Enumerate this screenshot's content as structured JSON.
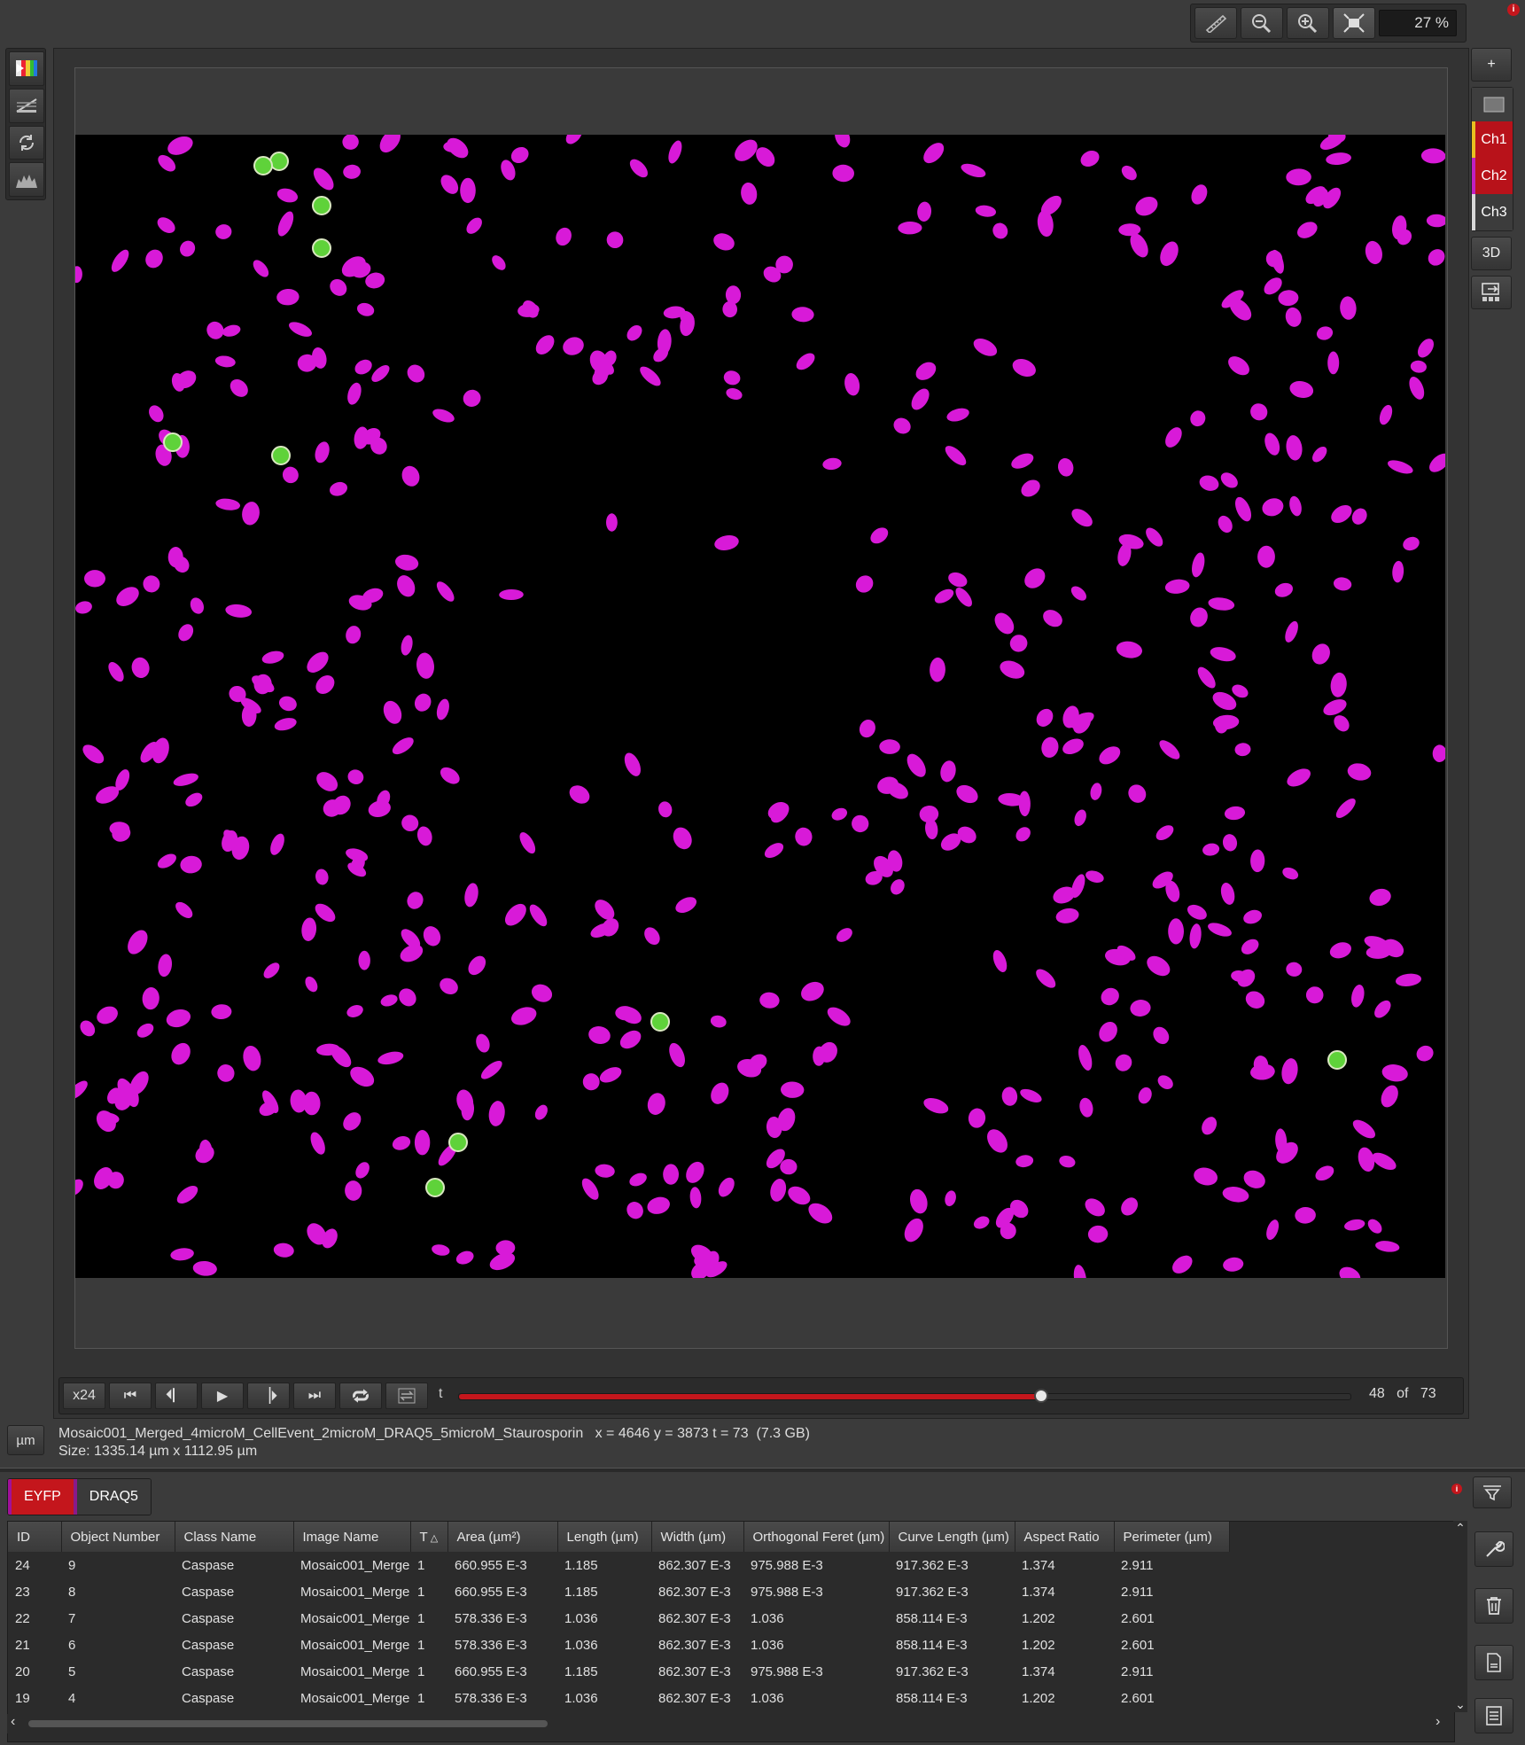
{
  "toolbar": {
    "buttons": [
      "ruler-icon",
      "zoom-out-icon",
      "zoom-in-icon",
      "fit-to-window-icon"
    ],
    "zoom": "27 %"
  },
  "left_tools": [
    "channel-color-icon",
    "display-adjust-icon",
    "refresh-icon",
    "histogram-icon"
  ],
  "right_panel": {
    "add": "+",
    "channels": [
      {
        "label": "Ch1",
        "color": "#b8121a",
        "stripe": "#e8c020"
      },
      {
        "label": "Ch2",
        "color": "#b8121a",
        "stripe": "#c020c0"
      },
      {
        "label": "Ch3",
        "color": "#3c3c3c",
        "stripe": "#d8d8d8"
      }
    ],
    "three_d": "3D"
  },
  "playback": {
    "speed": "x24",
    "t_label": "t",
    "current": "48",
    "of_label": "of",
    "total": "73",
    "progress": 0.653
  },
  "status": {
    "unit": "µm",
    "file_line": "Mosaic001_Merged_4microM_CellEvent_2microM_DRAQ5_5microM_Staurosporin   x = 4646 y = 3873 t = 73  (7.3 GB)",
    "size_line": "Size: 1335.14 µm x 1112.95 µm"
  },
  "tabs": [
    {
      "label": "EYFP",
      "active": true
    },
    {
      "label": "DRAQ5",
      "active": false
    }
  ],
  "table": {
    "columns": [
      "ID",
      "Object Number",
      "Class Name",
      "Image Name",
      "T",
      "Area (µm²)",
      "Length (µm)",
      "Width (µm)",
      "Orthogonal Feret (µm)",
      "Curve Length (µm)",
      "Aspect Ratio",
      "Perimeter (µm)"
    ],
    "rows": [
      [
        "24",
        "9",
        "Caspase",
        "Mosaic001_Merge",
        "1",
        "660.955 E-3",
        "1.185",
        "862.307 E-3",
        "975.988 E-3",
        "917.362 E-3",
        "1.374",
        "2.911"
      ],
      [
        "23",
        "8",
        "Caspase",
        "Mosaic001_Merge",
        "1",
        "660.955 E-3",
        "1.185",
        "862.307 E-3",
        "975.988 E-3",
        "917.362 E-3",
        "1.374",
        "2.911"
      ],
      [
        "22",
        "7",
        "Caspase",
        "Mosaic001_Merge",
        "1",
        "578.336 E-3",
        "1.036",
        "862.307 E-3",
        "1.036",
        "858.114 E-3",
        "1.202",
        "2.601"
      ],
      [
        "21",
        "6",
        "Caspase",
        "Mosaic001_Merge",
        "1",
        "578.336 E-3",
        "1.036",
        "862.307 E-3",
        "1.036",
        "858.114 E-3",
        "1.202",
        "2.601"
      ],
      [
        "20",
        "5",
        "Caspase",
        "Mosaic001_Merge",
        "1",
        "660.955 E-3",
        "1.185",
        "862.307 E-3",
        "975.988 E-3",
        "917.362 E-3",
        "1.374",
        "2.911"
      ],
      [
        "19",
        "4",
        "Caspase",
        "Mosaic001_Merge",
        "1",
        "578.336 E-3",
        "1.036",
        "862.307 E-3",
        "1.036",
        "858.114 E-3",
        "1.202",
        "2.601"
      ]
    ]
  },
  "colors": {
    "accent": "#c4161c",
    "nucleus": "#d81ad8",
    "apoptotic": "#5fd23a"
  }
}
